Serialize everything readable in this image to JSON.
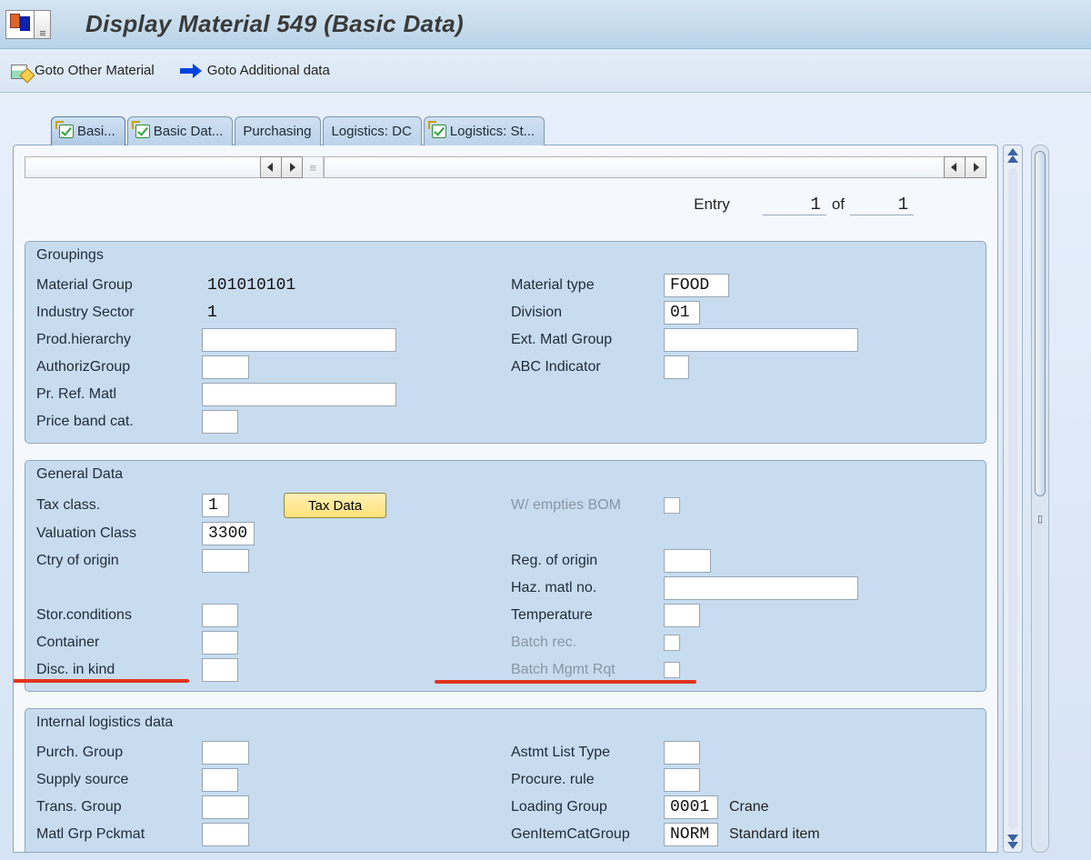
{
  "header": {
    "title": "Display Material 549 (Basic Data)"
  },
  "toolbar": {
    "goto_other": "Goto Other Material",
    "goto_additional": "Goto Additional data"
  },
  "tabs": {
    "t0": "Basi...",
    "t1": "Basic Dat...",
    "t2": "Purchasing",
    "t3": "Logistics: DC",
    "t4": "Logistics: St..."
  },
  "entry": {
    "label": "Entry",
    "current": "1",
    "of_label": "of",
    "total": "1"
  },
  "groupings": {
    "title": "Groupings",
    "material_group_lbl": "Material Group",
    "material_group_val": "101010101",
    "material_type_lbl": "Material type",
    "material_type_val": "FOOD",
    "industry_sector_lbl": "Industry Sector",
    "industry_sector_val": "1",
    "division_lbl": "Division",
    "division_val": "01",
    "prod_hierarchy_lbl": "Prod.hierarchy",
    "prod_hierarchy_val": "",
    "ext_matl_group_lbl": "Ext. Matl Group",
    "ext_matl_group_val": "",
    "authoriz_group_lbl": "AuthorizGroup",
    "authoriz_group_val": "",
    "abc_indicator_lbl": "ABC Indicator",
    "abc_indicator_val": "",
    "pr_ref_matl_lbl": "Pr. Ref. Matl",
    "pr_ref_matl_val": "",
    "price_band_cat_lbl": "Price band cat.",
    "price_band_cat_val": ""
  },
  "general": {
    "title": "General Data",
    "tax_class_lbl": "Tax class.",
    "tax_class_val": "1",
    "tax_data_btn": "Tax Data",
    "w_empties_bom_lbl": "W/ empties BOM",
    "valuation_class_lbl": "Valuation Class",
    "valuation_class_val": "3300",
    "ctry_origin_lbl": "Ctry of origin",
    "ctry_origin_val": "",
    "reg_origin_lbl": "Reg. of origin",
    "reg_origin_val": "",
    "haz_matl_lbl": "Haz. matl no.",
    "haz_matl_val": "",
    "stor_conditions_lbl": "Stor.conditions",
    "stor_conditions_val": "",
    "temperature_lbl": "Temperature",
    "temperature_val": "",
    "container_lbl": "Container",
    "container_val": "",
    "batch_rec_lbl": "Batch rec.",
    "disc_in_kind_lbl": "Disc. in kind",
    "disc_in_kind_val": "",
    "batch_mgmt_rqt_lbl": "Batch Mgmt Rqt"
  },
  "internal": {
    "title": "Internal logistics data",
    "purch_group_lbl": "Purch. Group",
    "purch_group_val": "",
    "astmt_list_type_lbl": "Astmt List Type",
    "astmt_list_type_val": "",
    "supply_source_lbl": "Supply source",
    "supply_source_val": "",
    "procure_rule_lbl": "Procure. rule",
    "procure_rule_val": "",
    "trans_group_lbl": "Trans. Group",
    "trans_group_val": "",
    "loading_group_lbl": "Loading Group",
    "loading_group_val": "0001",
    "loading_group_txt": "Crane",
    "matl_grp_pckmat_lbl": "Matl Grp Pckmat",
    "matl_grp_pckmat_val": "",
    "gen_item_cat_group_lbl": "GenItemCatGroup",
    "gen_item_cat_group_val": "NORM",
    "gen_item_cat_group_txt": "Standard item"
  }
}
